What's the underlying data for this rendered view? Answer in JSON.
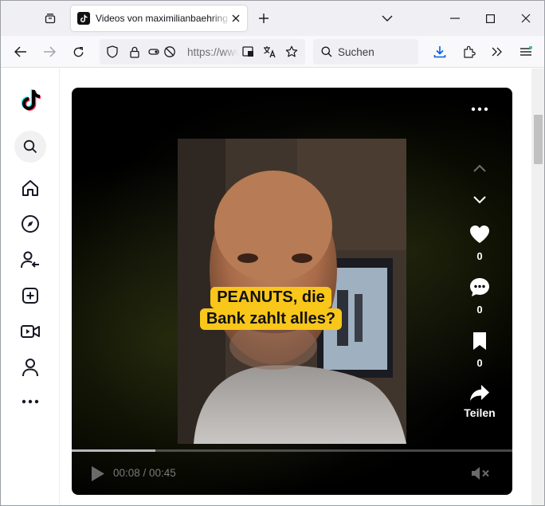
{
  "browser": {
    "tab_title": "Videos von maximilianbaehring",
    "url": "https://www.tiktok.com",
    "search_placeholder": "Suchen"
  },
  "video": {
    "caption_lines": [
      "PEANUTS, die",
      "Bank zahlt alles?"
    ],
    "likes": "0",
    "comments": "0",
    "saves": "0",
    "share_label": "Teilen",
    "current_time": "00:08",
    "duration": "00:45",
    "time_display": "00:08 / 00:45",
    "progress": 0.19
  },
  "colors": {
    "tiktok_cyan": "#25f4ee",
    "tiktok_pink": "#fe2c55",
    "caption_bg": "#f9c61a",
    "firefox_accent": "#0060df"
  },
  "icons": {
    "sidebar": [
      "tiktok-logo",
      "search-icon",
      "home-icon",
      "compass-icon",
      "following-icon",
      "upload-icon",
      "live-icon",
      "profile-icon",
      "more-icon"
    ],
    "toolbar": [
      "back-icon",
      "forward-icon",
      "reload-icon",
      "shield-icon",
      "lock-icon",
      "permissions-icon",
      "reader-icon",
      "translate-icon",
      "bookmark-star-icon",
      "download-icon",
      "extensions-icon",
      "overflow-icon",
      "menu-icon"
    ]
  }
}
